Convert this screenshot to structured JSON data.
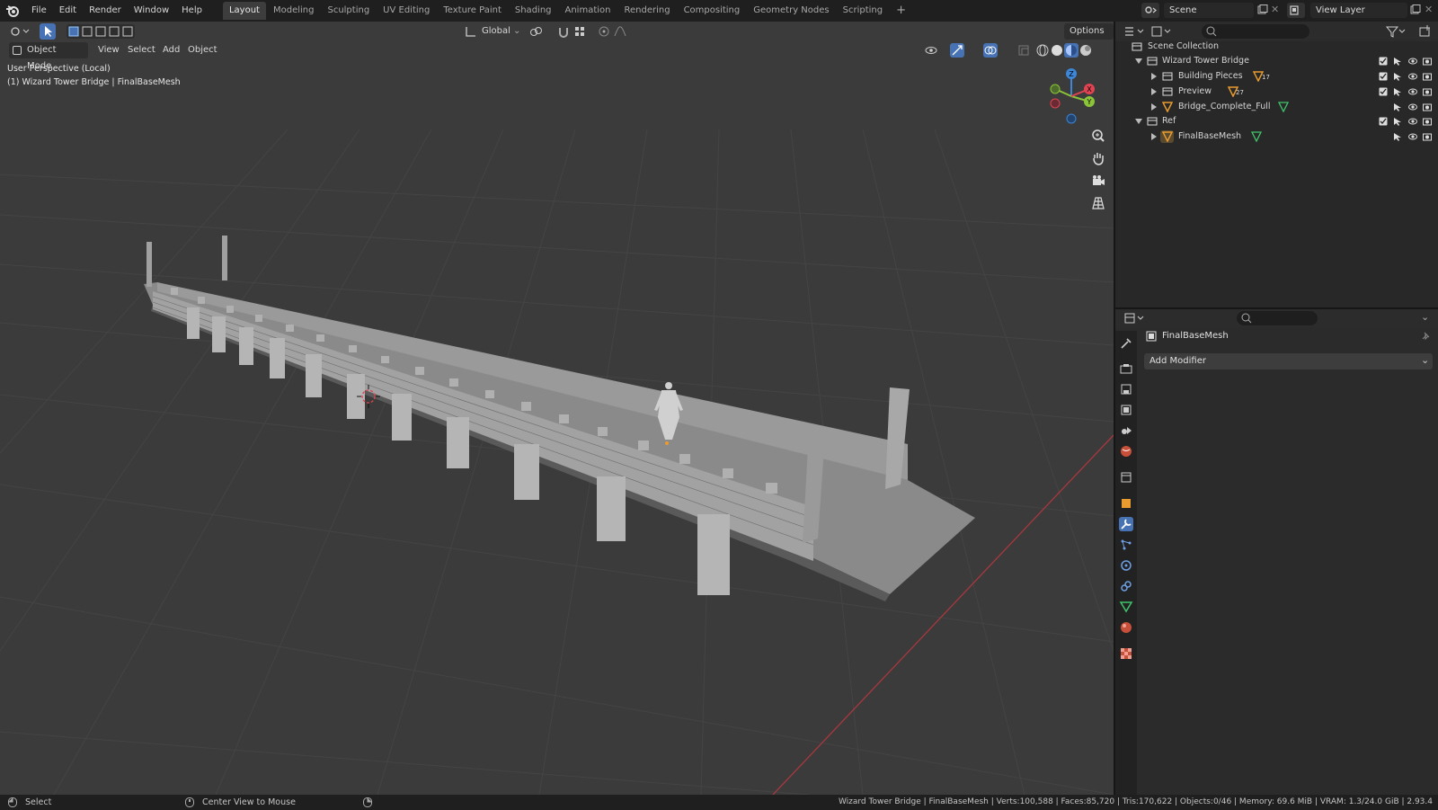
{
  "menu": {
    "items": [
      "File",
      "Edit",
      "Render",
      "Window",
      "Help"
    ]
  },
  "workspaces": [
    "Layout",
    "Modeling",
    "Sculpting",
    "UV Editing",
    "Texture Paint",
    "Shading",
    "Animation",
    "Rendering",
    "Compositing",
    "Geometry Nodes",
    "Scripting"
  ],
  "active_workspace": "Layout",
  "add_tab_glyph": "+",
  "scene": {
    "name": "Scene"
  },
  "view_layer": {
    "name": "View Layer"
  },
  "viewport": {
    "mode": "Object Mode",
    "menus": [
      "View",
      "Select",
      "Add",
      "Object"
    ],
    "transform_orientation": "Global",
    "options_label": "Options",
    "overlay_line1": "User Perspective (Local)",
    "overlay_line2": "(1) Wizard Tower Bridge | FinalBaseMesh",
    "gizmo_axes": {
      "x": "X",
      "y": "Y",
      "z": "Z"
    }
  },
  "outliner": {
    "root": "Scene Collection",
    "rows": [
      {
        "label": "Wizard Tower Bridge",
        "type": "collection"
      },
      {
        "label": "Building Pieces",
        "type": "collection",
        "badge": "17"
      },
      {
        "label": "Preview",
        "type": "collection",
        "badge": "27"
      },
      {
        "label": "Bridge_Complete_Full",
        "type": "object"
      },
      {
        "label": "Ref",
        "type": "collection"
      },
      {
        "label": "FinalBaseMesh",
        "type": "object"
      }
    ]
  },
  "properties": {
    "object_name": "FinalBaseMesh",
    "add_modifier_label": "Add Modifier",
    "active_tab": "modifiers"
  },
  "statusbar": {
    "left_action": "Select",
    "middle_action": "Center View to Mouse",
    "stats": "Wizard Tower Bridge | FinalBaseMesh | Verts:100,588 | Faces:85,720 | Tris:170,622 | Objects:0/46 | Memory: 69.6 MiB | VRAM: 1.3/24.0 GiB | 2.93.4"
  },
  "colors": {
    "accent_blue": "#4772b3",
    "x_axis": "#e04452",
    "y_axis": "#8bc43a",
    "z_axis": "#3d86d8",
    "mesh_orange": "#e89b2f",
    "data_green": "#3fc46a"
  }
}
